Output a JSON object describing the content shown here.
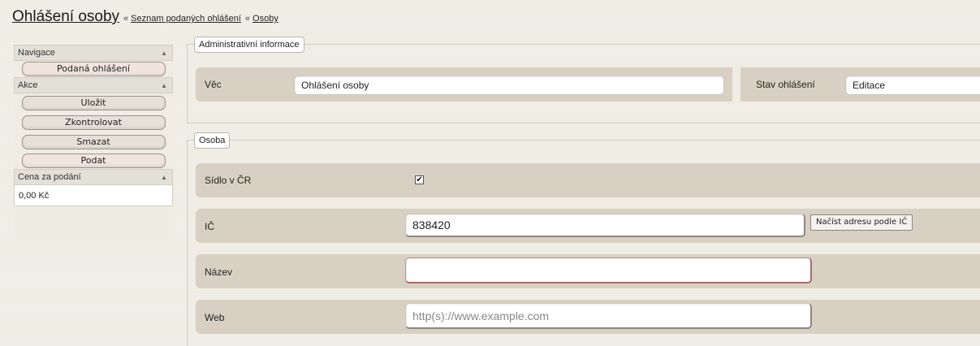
{
  "header": {
    "title": "Ohlášení osoby",
    "separator": "«",
    "breadcrumbs": [
      "Seznam podaných ohlášení",
      "Osoby"
    ]
  },
  "sidebar": {
    "navigace_label": "Navigace",
    "navigace_items": [
      "Podaná ohlášení"
    ],
    "akce_label": "Akce",
    "akce_items": [
      "Uložit",
      "Zkontrolovat",
      "Smazat",
      "Podat"
    ],
    "cena_label": "Cena za podání",
    "cena_value": "0,00 Kč"
  },
  "admin": {
    "legend": "Administrativní informace",
    "vec_label": "Věc",
    "vec_value": "Ohlášení osoby",
    "stav_label": "Stav ohlášení",
    "stav_value": "Editace"
  },
  "osoba": {
    "legend": "Osoba",
    "sidlo_label": "Sídlo v ČR",
    "sidlo_checked": true,
    "ic_label": "IČ",
    "ic_value": "838420",
    "ic_button": "Načíst adresu podle IČ",
    "nazev_label": "Název",
    "nazev_value": "",
    "web_label": "Web",
    "web_placeholder": "http(s)://www.example.com"
  },
  "icons": {
    "collapse": "triangle-up-icon",
    "check": "checkmark-icon"
  },
  "colors": {
    "row_bg": "#d8d1c3",
    "page_bg": "#efece3",
    "error_border": "#c98989"
  }
}
